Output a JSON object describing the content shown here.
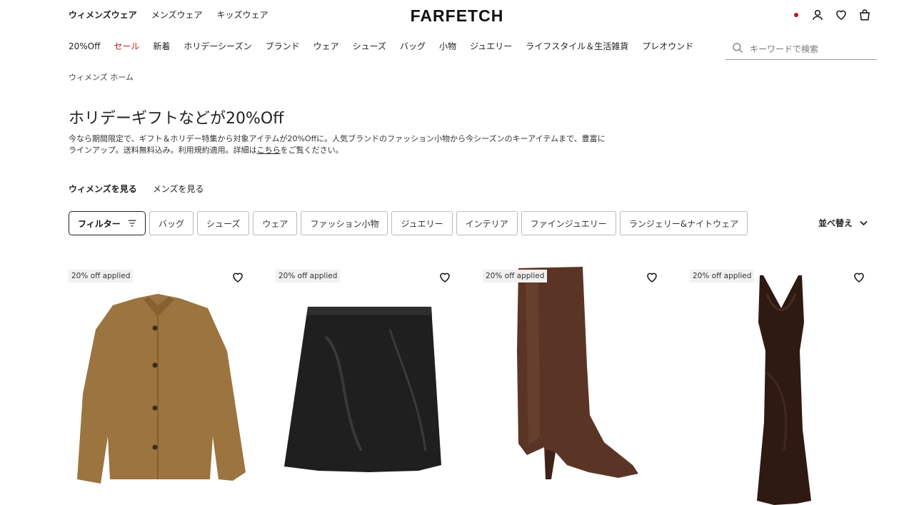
{
  "header": {
    "gender_nav": [
      "ウィメンズウェア",
      "メンズウェア",
      "キッズウェア"
    ],
    "logo": "FARFETCH"
  },
  "category_nav": [
    "20%Off",
    "セール",
    "新着",
    "ホリデーシーズン",
    "ブランド",
    "ウェア",
    "シューズ",
    "バッグ",
    "小物",
    "ジュエリー",
    "ライフスタイル＆生活雑貨",
    "プレオウンド"
  ],
  "search": {
    "placeholder": "キーワードで検索"
  },
  "breadcrumb": "ウィメンズ ホーム",
  "page": {
    "title": "ホリデーギフトなどが20%Off",
    "desc_part1": "今なら期間限定で、ギフト＆ホリデー特集から対象アイテムが20%Offに。人気ブランドのファッション小物から今シーズンのキーアイテムまで、豊富にラインアップ。送料無料込み。利用規約適用。詳細は",
    "desc_link": "こちら",
    "desc_part2": "をご覧ください。"
  },
  "gender_tabs": {
    "women": "ウィメンズを見る",
    "men": "メンズを見る"
  },
  "filters": {
    "filter_label": "フィルター",
    "chips": [
      "バッグ",
      "シューズ",
      "ウェア",
      "ファッション小物",
      "ジュエリー",
      "インテリア",
      "ファインジュエリー",
      "ランジェリー&ナイトウェア"
    ]
  },
  "sort": {
    "label": "並べ替え"
  },
  "products": [
    {
      "badge": "20% off applied",
      "kind": "jacket",
      "color": "#9c7440"
    },
    {
      "badge": "20% off applied",
      "kind": "skirt",
      "color": "#1f1f1f"
    },
    {
      "badge": "20% off applied",
      "kind": "boot",
      "color": "#5a3526"
    },
    {
      "badge": "20% off applied",
      "kind": "dress",
      "color": "#2e1a12"
    }
  ],
  "icons": {
    "flag": "japan-flag-icon",
    "account": "user-icon",
    "wishlist": "heart-icon",
    "bag": "shopping-bag-icon",
    "search": "search-icon",
    "filter": "filter-lines-icon",
    "sort": "chevron-down-icon"
  },
  "colors": {
    "sale": "#c4161c",
    "text": "#222222"
  }
}
